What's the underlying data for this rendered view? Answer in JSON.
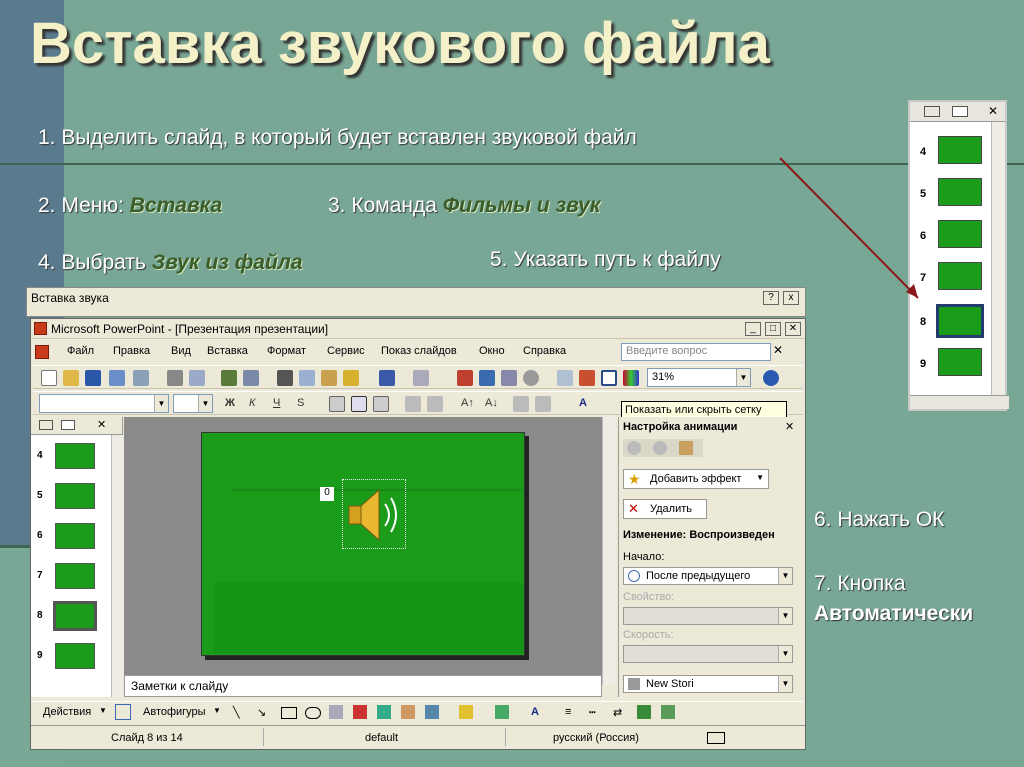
{
  "slide": {
    "title": "Вставка звукового файла",
    "step1": "1. Выделить слайд, в который будет вставлен звуковой файл",
    "step2_prefix": "2. Меню: ",
    "step2_em": "Вставка",
    "step3_prefix": "3. Команда ",
    "step3_em": "Фильмы и звук",
    "step4_prefix": "4. Выбрать ",
    "step4_em": "Звук из файла",
    "step5": "5. Указать путь к файлу",
    "step6": "6. Нажать ОК",
    "step7_line1": "7. Кнопка",
    "step7_line2": "Автоматически"
  },
  "mini_panel": {
    "slide_numbers": [
      "4",
      "5",
      "6",
      "7",
      "8",
      "9"
    ]
  },
  "dialog": {
    "title": "Вставка звука",
    "help": "?",
    "close": "x"
  },
  "ppt": {
    "title": "Microsoft PowerPoint - [Презентация презентации]",
    "menu": [
      "Файл",
      "Правка",
      "Вид",
      "Вставка",
      "Формат",
      "Сервис",
      "Показ слайдов",
      "Окно",
      "Справка"
    ],
    "ask_placeholder": "Введите вопрос",
    "zoom": "31%",
    "tooltip": "Показать или скрыть сетку",
    "thumb_numbers": [
      "4",
      "5",
      "6",
      "7",
      "8",
      "9"
    ],
    "notes_placeholder": "Заметки к слайду",
    "sound_badge": "0",
    "colors": {
      "slide_green": "#1a9b1a",
      "tooltip_bg": "#ffffe1"
    }
  },
  "taskpane": {
    "header": "Настройка анимации",
    "add_effect": "Добавить эффект",
    "remove": "Удалить",
    "change_label": "Изменение: Воспроизведен",
    "start_label": "Начало:",
    "start_value": "После предыдущего",
    "property_label": "Свойство:",
    "speed_label": "Скорость:",
    "list_item": "New Stori"
  },
  "drawbar": {
    "actions": "Действия",
    "autoshapes": "Автофигуры"
  },
  "statusbar": {
    "slide": "Слайд 8 из 14",
    "design": "default",
    "language": "русский (Россия)"
  }
}
